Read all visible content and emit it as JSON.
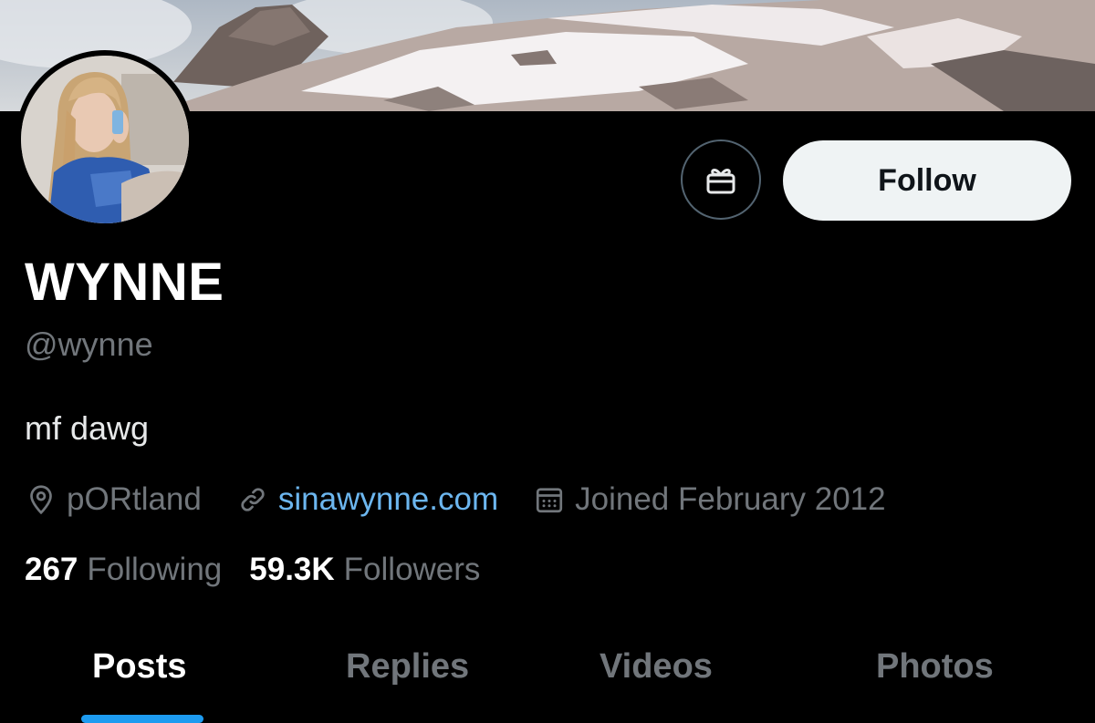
{
  "profile": {
    "display_name": "WYNNE",
    "handle": "@wynne",
    "bio": "mf dawg",
    "location": "pORtland",
    "website": "sinawynne.com",
    "joined": "Joined February 2012"
  },
  "actions": {
    "gift_icon": "gift-icon",
    "follow_label": "Follow"
  },
  "stats": {
    "following_count": "267",
    "following_label": "Following",
    "followers_count": "59.3K",
    "followers_label": "Followers"
  },
  "tabs": [
    {
      "label": "Posts",
      "active": true
    },
    {
      "label": "Replies",
      "active": false
    },
    {
      "label": "Videos",
      "active": false
    },
    {
      "label": "Photos",
      "active": false
    }
  ],
  "colors": {
    "background": "#000000",
    "accent": "#1d9bf0",
    "muted": "#71767b",
    "link": "#6cb6ef"
  }
}
